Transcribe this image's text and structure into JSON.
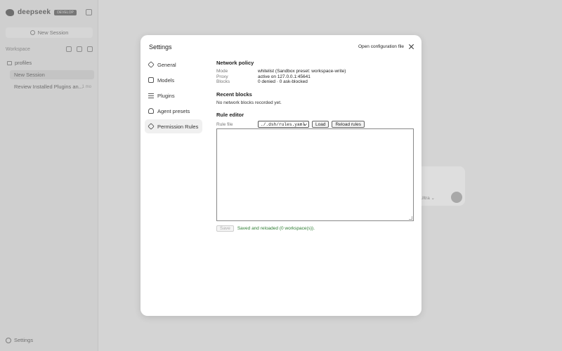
{
  "sidebar": {
    "brand": "deepseek",
    "badge": "DEVELOP",
    "new_session": "New Session",
    "workspace_label": "Workspace",
    "folder": "profiles",
    "sessions": [
      {
        "label": "New Session",
        "time": ""
      },
      {
        "label": "Review Installed Plugins an...",
        "time": "1 mo"
      }
    ],
    "settings_label": "Settings"
  },
  "composer": {
    "model_label": "Ultra ⌄"
  },
  "dialog": {
    "title": "Settings",
    "open_config_label": "Open configuration file",
    "nav": [
      {
        "label": "General",
        "icon": "hexagon-icon"
      },
      {
        "label": "Models",
        "icon": "models-icon"
      },
      {
        "label": "Plugins",
        "icon": "sliders-icon"
      },
      {
        "label": "Agent presets",
        "icon": "agent-icon"
      },
      {
        "label": "Permission Rules",
        "icon": "shield-icon",
        "active": true
      }
    ],
    "network_policy": {
      "title": "Network policy",
      "rows": [
        {
          "key": "Mode",
          "value": "whitelist (Sandbox preset: workspace-write)"
        },
        {
          "key": "Proxy",
          "value": "active on 127.0.0.1:45641"
        },
        {
          "key": "Blocks",
          "value": "0 denied · 0 ask-blocked"
        }
      ]
    },
    "recent_blocks": {
      "title": "Recent blocks",
      "empty_text": "No network blocks recorded yet."
    },
    "rule_editor": {
      "title": "Rule editor",
      "file_label": "Rule file",
      "selected_file": "./.dsh/rules.yaml",
      "load_label": "Load",
      "reload_label": "Reload rules",
      "editor_value": "",
      "save_label": "Save",
      "status": "Saved and reloaded (0 workspace(s))."
    }
  }
}
